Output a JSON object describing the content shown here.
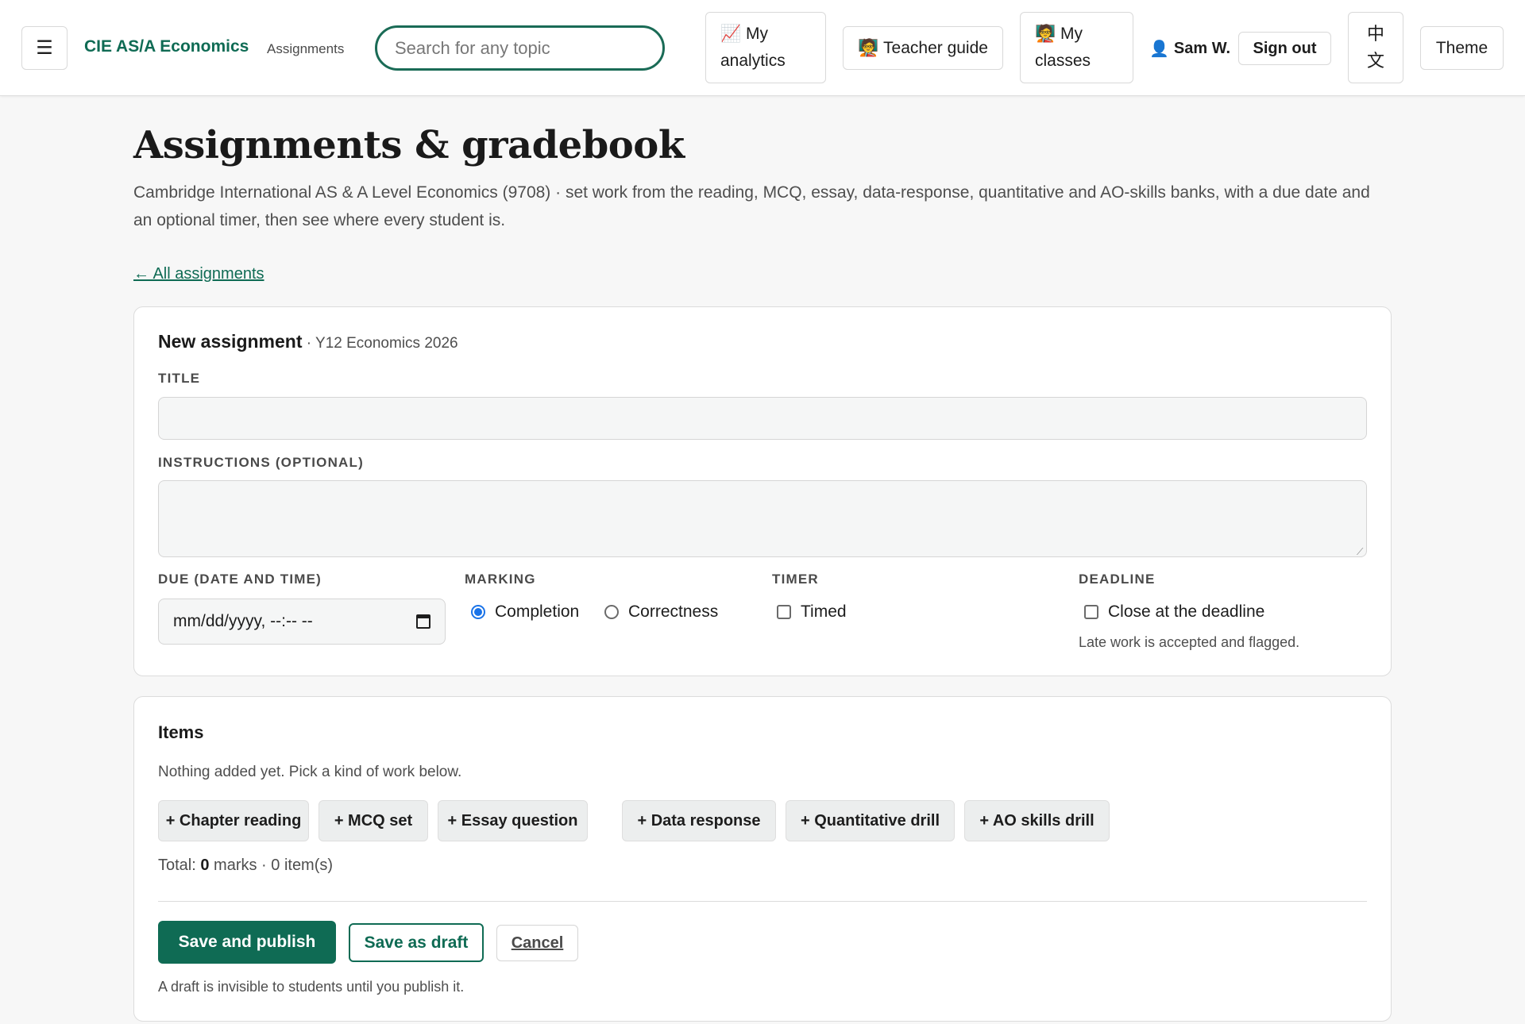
{
  "header": {
    "menu_icon": "☰",
    "brand": "CIE AS/A Economics",
    "section": "Assignments",
    "search_placeholder": "Search for any topic",
    "nav": {
      "analytics_icon": "📈",
      "analytics_line1": "My",
      "analytics_line2": "analytics",
      "guide_icon": "🧑‍🏫",
      "guide_label": "Teacher guide",
      "classes_icon": "🧑‍🏫",
      "classes_line1": "My",
      "classes_line2": "classes"
    },
    "user_icon": "👤",
    "user_name": "Sam W.",
    "sign_out": "Sign out",
    "lang_line1": "中",
    "lang_line2": "文",
    "theme": "Theme"
  },
  "page": {
    "title": "Assignments & gradebook",
    "description": "Cambridge International AS & A Level Economics (9708) · set work from the reading, MCQ, essay, data-response, quantitative and AO-skills banks, with a due date and an optional timer, then see where every student is.",
    "back_link": "← All assignments"
  },
  "new_assignment": {
    "title": "New assignment",
    "class_name": " · Y12 Economics 2026",
    "title_label": "TITLE",
    "title_value": "",
    "instructions_label": "INSTRUCTIONS (OPTIONAL)",
    "instructions_value": "",
    "due_label": "DUE (DATE AND TIME)",
    "due_placeholder": "mm/dd/yyyy, --:-- --",
    "marking_label": "MARKING",
    "marking_options": [
      "Completion",
      "Correctness"
    ],
    "marking_selected": "Completion",
    "timer_label": "TIMER",
    "timer_option": "Timed",
    "timer_checked": false,
    "deadline_label": "DEADLINE",
    "deadline_option": "Close at the deadline",
    "deadline_checked": false,
    "deadline_hint": "Late work is accepted and flagged."
  },
  "items": {
    "title": "Items",
    "empty_text": "Nothing added yet. Pick a kind of work below.",
    "work_types": [
      "+ Chapter reading",
      "+ MCQ set",
      "+ Essay question",
      "+ Data response",
      "+ Quantitative drill",
      "+ AO skills drill"
    ],
    "total_prefix": "Total: ",
    "total_marks": "0",
    "total_suffix": " marks · 0 item(s)",
    "save_publish": "Save and publish",
    "save_draft": "Save as draft",
    "cancel": "Cancel",
    "draft_note": "A draft is invisible to students until you publish it."
  },
  "colors": {
    "brand": "#0f6b54",
    "radio_accent": "#1a73e8",
    "page_bg": "#f7f7f7"
  }
}
